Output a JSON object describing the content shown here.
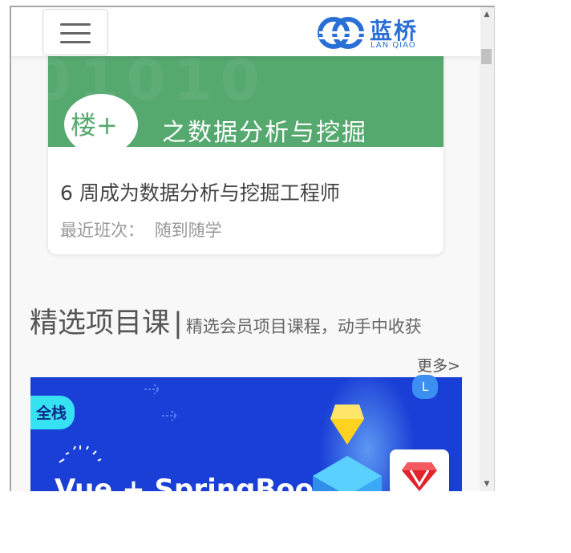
{
  "header": {
    "logo_text": "蓝桥",
    "logo_sub": "LAN QIAO",
    "menu_icon": "hamburger-menu-icon"
  },
  "course_card": {
    "banner_badge": "楼+",
    "banner_title": "之数据分析与挖掘",
    "title": "6 周成为数据分析与挖掘工程师",
    "meta_label": "最近班次：",
    "meta_value": "随到随学",
    "banner_color": "#55a86e"
  },
  "section": {
    "title": "精选项目课",
    "divider": "|",
    "subtitle": "精选会员项目课程，动手中收获",
    "more_link": "更多>"
  },
  "promo": {
    "tag": "全栈",
    "title": "Vue + SpringBoot",
    "bg_color": "#1a3fd6",
    "avatar_letter": "L",
    "float_icon": "ruby-icon"
  },
  "scrollbar": {
    "up_icon": "▲",
    "down_icon": "▼"
  }
}
